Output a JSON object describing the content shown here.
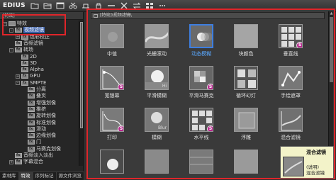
{
  "app": {
    "logo": "EDIUS"
  },
  "toolbar": {
    "icons": [
      "folder-icon",
      "folder-open-icon",
      "window-icon",
      "scissors-icon",
      "layout-icon",
      "lock-icon",
      "dash-icon",
      "close-x-icon",
      "swap-icon",
      "grid-icon",
      "more-icon"
    ]
  },
  "left_panel": {
    "header": "[特效]",
    "tree": [
      {
        "label": "特效",
        "level": 0,
        "icon": "folder-icon",
        "expander": "-"
      },
      {
        "label": "视频滤镜",
        "level": 1,
        "icon": "folder-fx-icon",
        "expander": "-",
        "selected": true
      },
      {
        "label": "色彩校正",
        "level": 2,
        "icon": "folder-fx-icon",
        "expander": "+"
      },
      {
        "label": "音频滤镜",
        "level": 1,
        "icon": "folder-fx-icon",
        "expander": ""
      },
      {
        "label": "转场",
        "level": 1,
        "icon": "folder-fx-icon",
        "expander": "-"
      },
      {
        "label": "2D",
        "level": 2,
        "icon": "folder-fx-icon",
        "expander": ""
      },
      {
        "label": "3D",
        "level": 2,
        "icon": "folder-fx-icon",
        "expander": ""
      },
      {
        "label": "Alpha",
        "level": 2,
        "icon": "folder-fx-icon",
        "expander": ""
      },
      {
        "label": "GPU",
        "level": 2,
        "icon": "folder-fx-icon",
        "expander": "+"
      },
      {
        "label": "SMPTE",
        "level": 2,
        "icon": "folder-fx-icon",
        "expander": "-"
      },
      {
        "label": "分离",
        "level": 3,
        "icon": "folder-fx-icon",
        "expander": ""
      },
      {
        "label": "叠页",
        "level": 3,
        "icon": "folder-fx-icon",
        "expander": ""
      },
      {
        "label": "增强划像",
        "level": 3,
        "icon": "folder-fx-icon",
        "expander": ""
      },
      {
        "label": "推挤",
        "level": 3,
        "icon": "folder-fx-icon",
        "expander": ""
      },
      {
        "label": "旋转划像",
        "level": 3,
        "icon": "folder-fx-icon",
        "expander": ""
      },
      {
        "label": "标准划像",
        "level": 3,
        "icon": "folder-fx-icon",
        "expander": ""
      },
      {
        "label": "滑动",
        "level": 3,
        "icon": "folder-fx-icon",
        "expander": ""
      },
      {
        "label": "边缘划像",
        "level": 3,
        "icon": "folder-fx-icon",
        "expander": ""
      },
      {
        "label": "门",
        "level": 3,
        "icon": "folder-fx-icon",
        "expander": ""
      },
      {
        "label": "马赛克划像",
        "level": 3,
        "icon": "folder-fx-icon",
        "expander": ""
      },
      {
        "label": "音频淡入淡出",
        "level": 1,
        "icon": "folder-fx-icon",
        "expander": ""
      },
      {
        "label": "字幕混合",
        "level": 1,
        "icon": "folder-fx-icon",
        "expander": "+"
      }
    ],
    "tabs": [
      "素材库",
      "特效",
      "序列标记",
      "源文件浏览"
    ]
  },
  "right_panel": {
    "path": "[特效]\\视频滤镜\\",
    "effects": [
      {
        "name": "中值",
        "thumb": "gray",
        "badge": false,
        "selected": false
      },
      {
        "name": "光栅滚动",
        "thumb": "wave",
        "badge": false,
        "selected": false
      },
      {
        "name": "动态模糊",
        "thumb": "blur-dot",
        "badge": false,
        "selected": true
      },
      {
        "name": "块颜色",
        "thumb": "solid",
        "badge": false,
        "selected": false
      },
      {
        "name": "垂直线",
        "thumb": "grid",
        "badge": true,
        "selected": false
      },
      {
        "name": "宽银幕",
        "thumb": "curve",
        "badge": true,
        "selected": false
      },
      {
        "name": "平滑模糊",
        "thumb": "sphere",
        "badge": false,
        "selected": false
      },
      {
        "name": "平滑马赛克",
        "thumb": "mosaic",
        "badge": true,
        "selected": false
      },
      {
        "name": "循环幻灯",
        "thumb": "squares",
        "badge": false,
        "selected": false
      },
      {
        "name": "手绘遮罩",
        "thumb": "hand",
        "badge": false,
        "selected": false
      },
      {
        "name": "打印",
        "thumb": "curve2",
        "badge": true,
        "selected": false
      },
      {
        "name": "模糊",
        "thumb": "blur-text",
        "badge": false,
        "selected": false
      },
      {
        "name": "水平线",
        "thumb": "grid2",
        "badge": true,
        "selected": false
      },
      {
        "name": "浮雕",
        "thumb": "emboss",
        "badge": false,
        "selected": false
      },
      {
        "name": "混合滤镜",
        "thumb": "stripe",
        "badge": false,
        "selected": false
      },
      {
        "name": "",
        "thumb": "light",
        "badge": false,
        "selected": false
      },
      {
        "name": "",
        "thumb": "gray2",
        "badge": false,
        "selected": false
      },
      {
        "name": "",
        "thumb": "lines",
        "badge": false,
        "selected": false
      },
      {
        "name": "",
        "thumb": "gray3",
        "badge": false,
        "selected": false
      }
    ],
    "thumb_labels": {
      "hi": "Hi",
      "blur": "Blur"
    }
  },
  "tooltip": {
    "title": "混合滤镜",
    "line1": "(说明)",
    "line2": "混合滤镜"
  },
  "colors": {
    "highlight": "#e0252a",
    "selection": "#3a5fa8",
    "badge": "#b8278e"
  }
}
